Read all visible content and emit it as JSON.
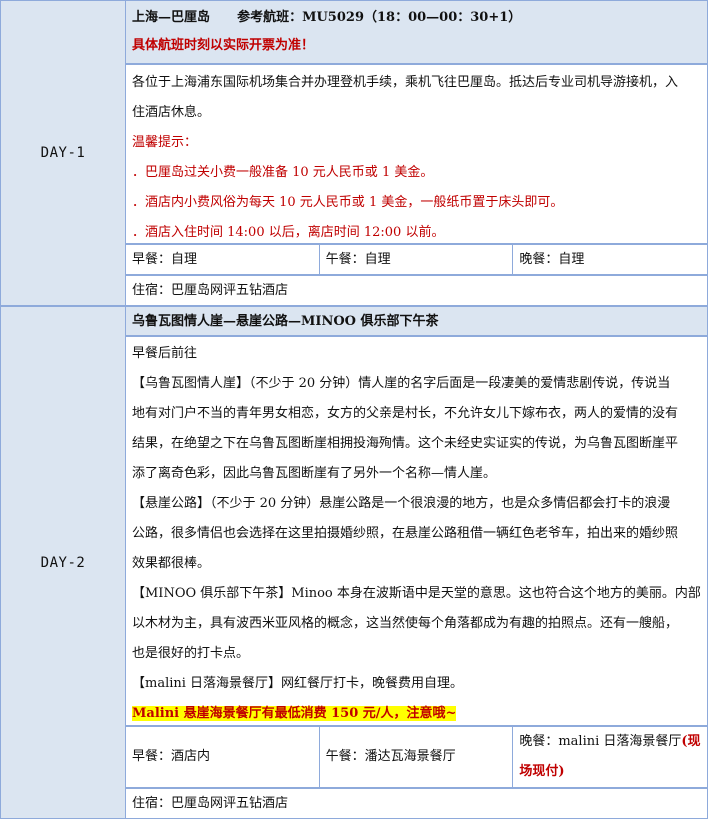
{
  "day1": {
    "label": "DAY-1",
    "route": "上海—巴厘岛",
    "flight": "参考航班：MU5029（18：00—00：30+1）",
    "flight_note": "具体航班时刻以实际开票为准！",
    "desc_line1": "各位于上海浦东国际机场集合并办理登机手续，乘机飞往巴厘岛。抵达后专业司机导游接机，入",
    "desc_line2": "住酒店休息。",
    "tips_title": "温馨提示：",
    "tips": [
      "．巴厘岛过关小费一般准备 10 元人民币或 1 美金。",
      "．酒店内小费风俗为每天 10 元人民币或 1 美金，一般纸币置于床头即可。",
      "．酒店入住时间 14:00 以后，离店时间 12:00 以前。"
    ],
    "breakfast": "早餐：自理",
    "lunch": "午餐：自理",
    "dinner": "晚餐：自理",
    "hotel": "住宿：巴厘岛网评五钻酒店"
  },
  "day2": {
    "label": "DAY-2",
    "title": "乌鲁瓦图情人崖—悬崖公路—MINOO 俱乐部下午茶",
    "intro": "早餐后前往",
    "p1": [
      "【乌鲁瓦图情人崖】（不少于 20 分钟）情人崖的名字后面是一段凄美的爱情悲剧传说，传说当",
      "地有对门户不当的青年男女相恋，女方的父亲是村长，不允许女儿下嫁布衣，两人的爱情的没有",
      "结果，在绝望之下在乌鲁瓦图断崖相拥投海殉情。这个未经史实证实的传说，为乌鲁瓦图断崖平",
      "添了离奇色彩，因此乌鲁瓦图断崖有了另外一个名称—情人崖。"
    ],
    "p2": [
      "【悬崖公路】（不少于 20 分钟）悬崖公路是一个很浪漫的地方，也是众多情侣都会打卡的浪漫",
      "公路，很多情侣也会选择在这里拍摄婚纱照，在悬崖公路租借一辆红色老爷车，拍出来的婚纱照",
      "效果都很棒。"
    ],
    "p3": [
      "【MINOO 俱乐部下午茶】Minoo 本身在波斯语中是天堂的意思。这也符合这个地方的美丽。内部",
      "以木材为主，具有波西米亚风格的概念，这当然使每个角落都成为有趣的拍照点。还有一艘船，",
      "也是很好的打卡点。"
    ],
    "p4": "【malini 日落海景餐厅】网红餐厅打卡，晚餐费用自理。",
    "warning": "Malini 悬崖海景餐厅有最低消费 150 元/人，注意哦~",
    "breakfast": "早餐：酒店内",
    "lunch": "午餐：潘达瓦海景餐厅",
    "dinner_prefix": "晚餐：malini 日落海景餐厅",
    "dinner_note_a": "(现",
    "dinner_note_b": "场现付)",
    "hotel": "住宿：巴厘岛网评五钻酒店"
  }
}
